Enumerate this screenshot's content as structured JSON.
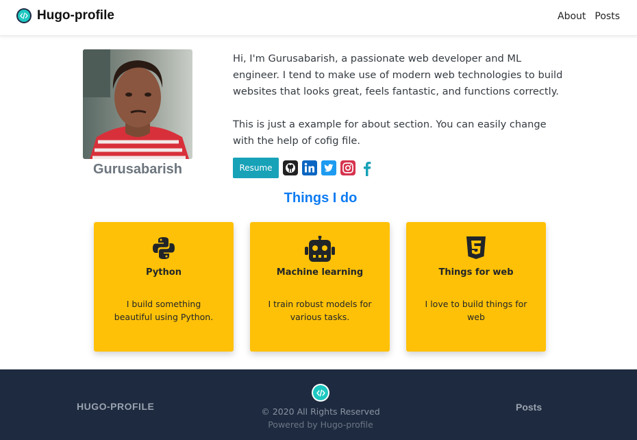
{
  "navbar": {
    "brand": "Hugo-profile",
    "links": [
      "About",
      "Posts"
    ]
  },
  "about": {
    "name": "Gurusabarish",
    "bio": [
      "Hi, I'm Gurusabarish, a passionate web developer and ML engineer. I tend to make use of modern web technologies to build websites that looks great, feels fantastic, and functions correctly.",
      "This is just a example for about section. You can easily change with the help of cofig file."
    ],
    "resume_label": "Resume",
    "socials": [
      "github-icon",
      "linkedin-icon",
      "twitter-icon",
      "instagram-icon",
      "facebook-icon"
    ]
  },
  "things_i_do": {
    "title": "Things I do",
    "cards": [
      {
        "icon": "python-icon",
        "title": "Python",
        "text": "I build something beautiful using Python."
      },
      {
        "icon": "robot-icon",
        "title": "Machine learning",
        "text": "I train robust models for various tasks."
      },
      {
        "icon": "html5-icon",
        "title": "Things for web",
        "text": "I love to build things for web"
      }
    ]
  },
  "footer": {
    "brand": "HUGO-PROFILE",
    "copyright": "© 2020 All Rights Reserved",
    "powered": "Powered by Hugo-profile",
    "link": "Posts"
  },
  "colors": {
    "accent": "#17a2b8",
    "section_title": "#0d7bf2",
    "card_bg": "#ffc107",
    "footer_bg": "#1e2a3f"
  }
}
